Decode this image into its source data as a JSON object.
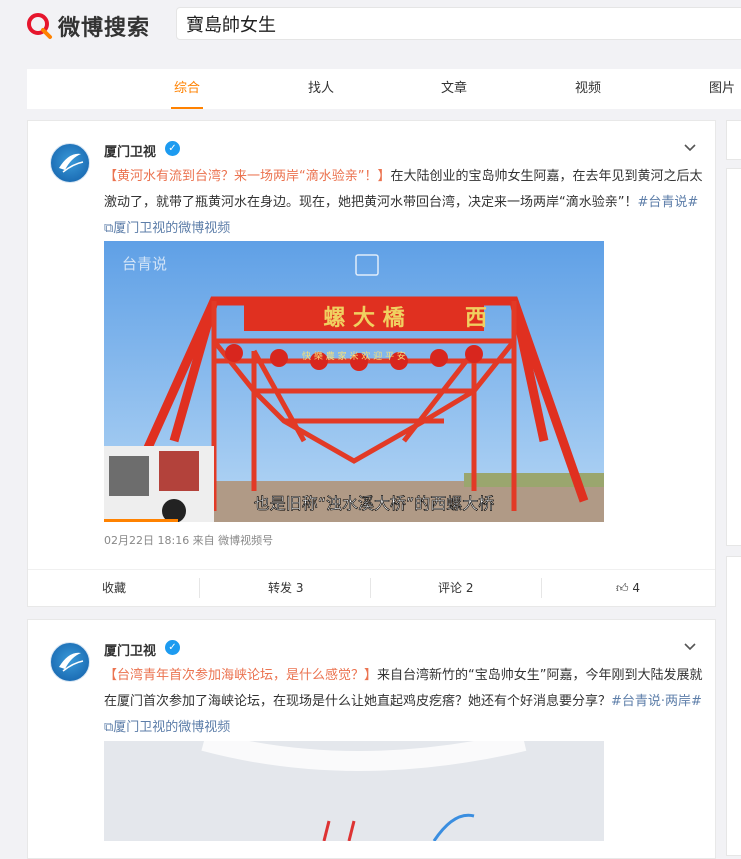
{
  "header": {
    "logo_text": "微博搜索",
    "search_value": "寶島帥女生"
  },
  "tabs": [
    "综合",
    "找人",
    "文章",
    "视频",
    "图片"
  ],
  "colors": {
    "accent": "#ff8200",
    "highlight": "#eb7350",
    "link": "#5d7ea9",
    "verified": "#1d9bf0"
  },
  "posts": [
    {
      "user": "厦门卫视",
      "verified_icon": "verified-badge-icon",
      "title": "【黄河水有流到台湾？来一场两岸“滴水验亲”！】",
      "body": "在大陆创业的宝岛帅女生阿嘉，在去年见到黄河之后太激动了，就带了瓶黄河水在身边。现在，她把黄河水带回台湾，决定来一场两岸“滴水验亲”！",
      "tag": "#台青说#",
      "video_link": "厦门卫视的微博视频",
      "video": {
        "watermark": "台青说",
        "sign_left": "西",
        "sign_main": "螺 大 橋",
        "banner": "快 樂 農 家 米 欢 迎 平 安",
        "subtitle": "也是旧称“浊水溪大桥”的西螺大桥"
      },
      "meta": "02月22日 18:16  来自 微博视频号",
      "actions": {
        "collect": "收藏",
        "repost": "转发 3",
        "comment": "评论 2",
        "like_count": "4"
      }
    },
    {
      "user": "厦门卫视",
      "verified_icon": "verified-badge-icon",
      "title": "【台湾青年首次参加海峡论坛，是什么感觉？】",
      "body": "来自台湾新竹的“宝岛帅女生”阿嘉，今年刚到大陆发展就在厦门首次参加了海峡论坛，在现场是什么让她直起鸡皮疙瘩？她还有个好消息要分享？",
      "tag": "#台青说·两岸#",
      "video_link": "厦门卫视的微博视频"
    }
  ]
}
